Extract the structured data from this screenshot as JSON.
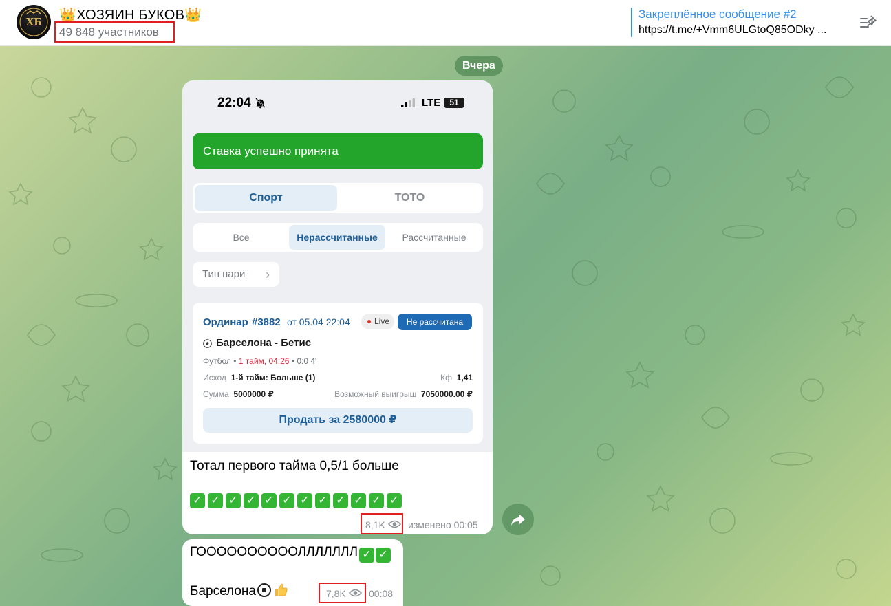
{
  "header": {
    "title_prefix": "👑",
    "title": "ХОЗЯИН БУКОВ",
    "title_suffix": "👑",
    "members": "49 848 участников",
    "avatar_letters": "ХБ"
  },
  "pinned": {
    "title": "Закреплённое сообщение #2",
    "text": "https://t.me/+Vmm6ULGtoQ85ODky ..."
  },
  "date_chip": "Вчера",
  "screenshot": {
    "status_time": "22:04",
    "network": "LTE",
    "battery": "51",
    "success_banner": "Ставка успешно принята",
    "tabs": [
      "Спорт",
      "ТОТО"
    ],
    "filters": [
      "Все",
      "Нерассчитанные",
      "Рассчитанные"
    ],
    "type_chip": "Тип пари",
    "bet": {
      "type": "Ординар",
      "number": "#3882",
      "date": "от 05.04 22:04",
      "live": "Live",
      "status": "Не рассчитана",
      "match": "Барселона - Бетис",
      "meta_sport": "Футбол",
      "meta_period": "1 тайм, 04:26",
      "meta_score": "0:0 4'",
      "outcome_label": "Исход",
      "outcome_value": "1-й тайм: Больше (1)",
      "coef_label": "Кф",
      "coef_value": "1,41",
      "sum_label": "Сумма",
      "sum_value": "5000000 ₽",
      "win_label": "Возможный выигрыш",
      "win_value": "7050000.00 ₽",
      "sell_button": "Продать за 2580000 ₽"
    }
  },
  "message1": {
    "text": "Тотал первого тайма 0,5/1 больше",
    "check_count": 12,
    "check_glyph": "✓",
    "views": "8,1K",
    "edited": "изменено 00:05"
  },
  "message2": {
    "line1": "ГООООООООООЛЛЛЛЛЛЛ",
    "line2": "Барселона",
    "views": "7,8K",
    "time": "00:08"
  },
  "colors": {
    "accent": "#3390ec",
    "success": "#22a52a",
    "highlight_box": "#e02020"
  }
}
